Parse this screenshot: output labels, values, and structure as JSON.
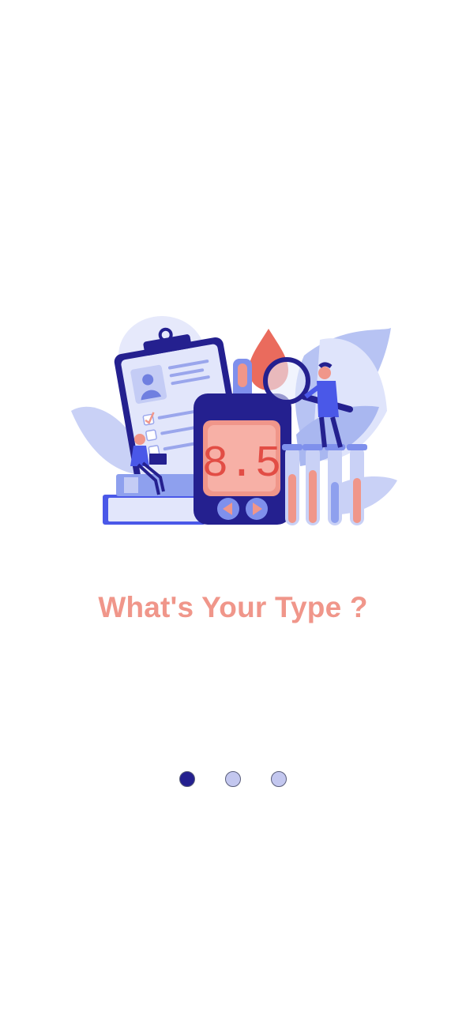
{
  "onboarding": {
    "title": "What's Your Type ?",
    "title_color": "#f0968a",
    "illustration": {
      "icon": "glucose-meter-illustration",
      "meter_reading": "8.5"
    },
    "pagination": {
      "total": 3,
      "active_index": 0,
      "active_color": "#24208f",
      "inactive_color": "#c3c7ef",
      "items": [
        {
          "label": "page-1",
          "active": true
        },
        {
          "label": "page-2",
          "active": false
        },
        {
          "label": "page-3",
          "active": false
        }
      ]
    }
  }
}
